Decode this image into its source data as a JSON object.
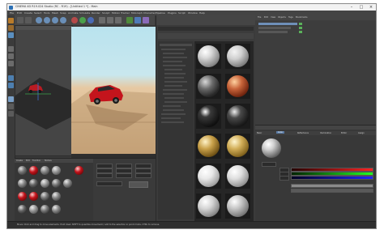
{
  "window": {
    "title": "CINEMA 4D R19.024 Studio (RC - R19) - [Untitled 1 *] - Main"
  },
  "menubar": {
    "items": [
      "File",
      "Edit",
      "Create",
      "Select",
      "Tools",
      "Mesh",
      "Snap",
      "Animate",
      "Simulate",
      "Render",
      "Sculpt",
      "Motion Tracker",
      "MoGraph",
      "Character",
      "Pipeline",
      "Plugins",
      "Script",
      "Window",
      "Help"
    ]
  },
  "object_manager": {
    "menu": [
      "File",
      "Edit",
      "View",
      "Objects",
      "Tags",
      "Bookmarks"
    ]
  },
  "attribute_manager": {
    "tabs": [
      "Basic",
      "Color",
      "Reflectance",
      "Illumination",
      "Editor",
      "Assign"
    ]
  },
  "material_manager": {
    "menu": [
      "Create",
      "Edit",
      "Function",
      "Texture"
    ]
  },
  "render_view": {
    "status_text": ""
  },
  "status_bar": {
    "text": "Move: Click and drag to move elements. Hold down SHIFT to quantize movement / add to the selection in point mode, CTRL to remove."
  },
  "colors": {
    "ui_bg": "#393939",
    "accent": "#2a6fb5",
    "car_red": "#c4141c"
  }
}
